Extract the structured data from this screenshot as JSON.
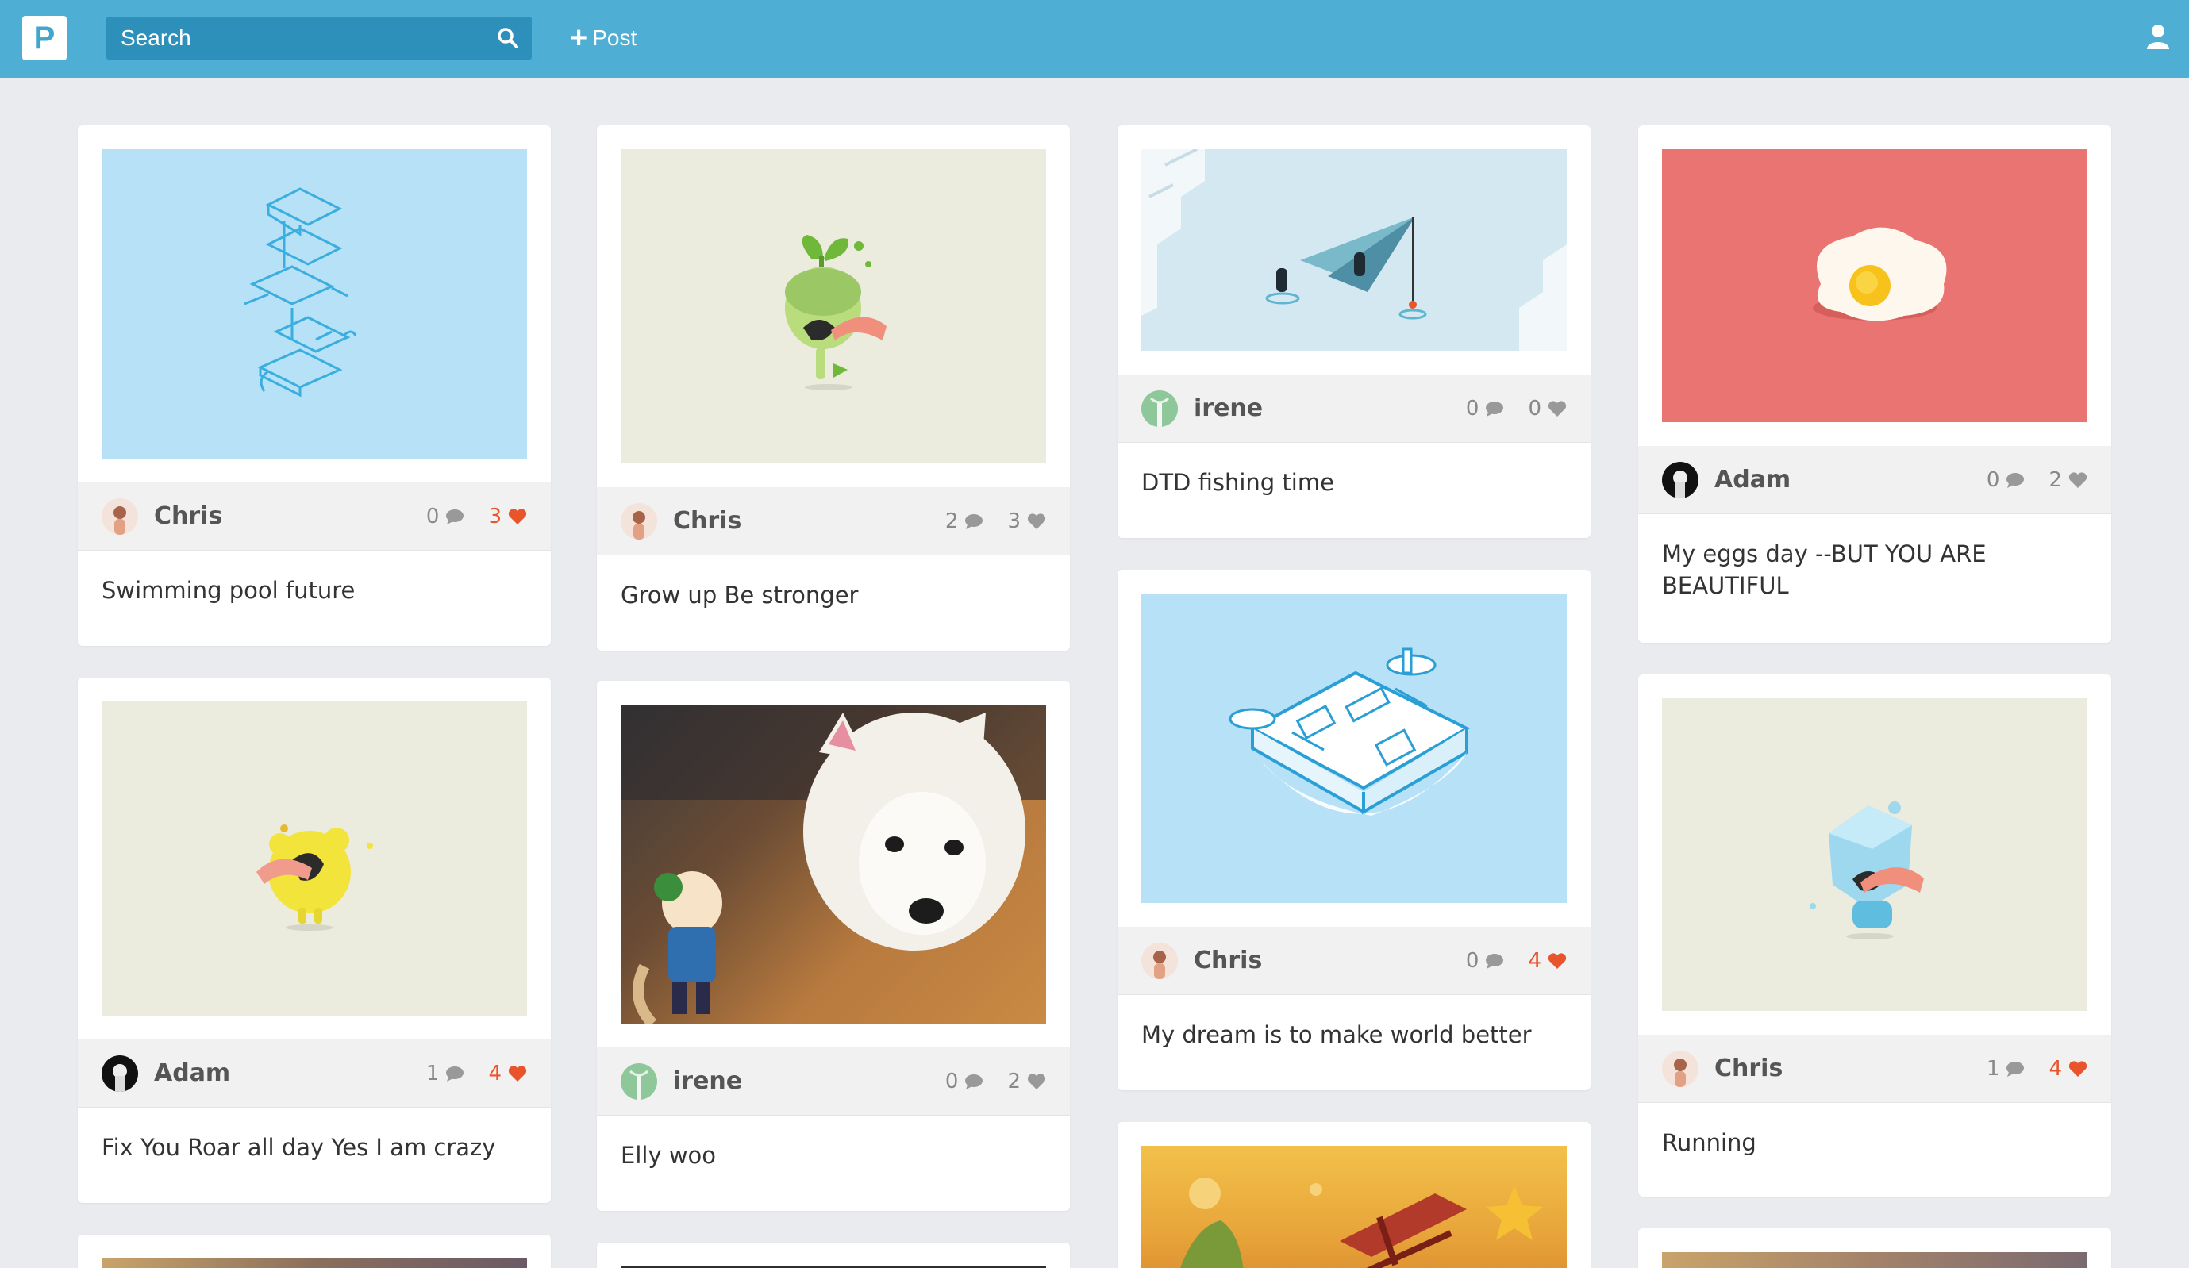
{
  "header": {
    "logo_letter": "P",
    "search_placeholder": "Search",
    "post_label": "Post"
  },
  "cards": [
    {
      "user": "Chris",
      "comments": "0",
      "likes": "3",
      "liked": true,
      "caption": "Swimming pool future",
      "image": "isometric-phones-illustration"
    },
    {
      "user": "Chris",
      "comments": "2",
      "likes": "3",
      "liked": false,
      "caption": "Grow up Be stronger",
      "image": "green-monster-illustration"
    },
    {
      "user": "irene",
      "comments": "0",
      "likes": "0",
      "liked": false,
      "caption": "DTD fishing time",
      "image": "paper-plane-illustration"
    },
    {
      "user": "Adam",
      "comments": "0",
      "likes": "2",
      "liked": false,
      "caption": "My eggs day --BUT YOU ARE BEAUTIFUL",
      "image": "fried-egg-illustration"
    },
    {
      "user": "Adam",
      "comments": "1",
      "likes": "4",
      "liked": true,
      "caption": "Fix You Roar all day Yes I am crazy",
      "image": "yellow-monster-illustration"
    },
    {
      "user": "irene",
      "comments": "0",
      "likes": "2",
      "liked": false,
      "caption": "Elly woo",
      "image": "white-dog-photo"
    },
    {
      "user": "Chris",
      "comments": "0",
      "likes": "4",
      "liked": true,
      "caption": "My dream is to make world better",
      "image": "circuit-board-illustration"
    },
    {
      "user": "Chris",
      "comments": "1",
      "likes": "4",
      "liked": true,
      "caption": "Running",
      "image": "blue-monster-illustration"
    }
  ],
  "colors": {
    "topbar": "#4eaed3",
    "search_bg": "#2c90ba",
    "like_active": "#e8542c",
    "background": "#e9ebee"
  }
}
